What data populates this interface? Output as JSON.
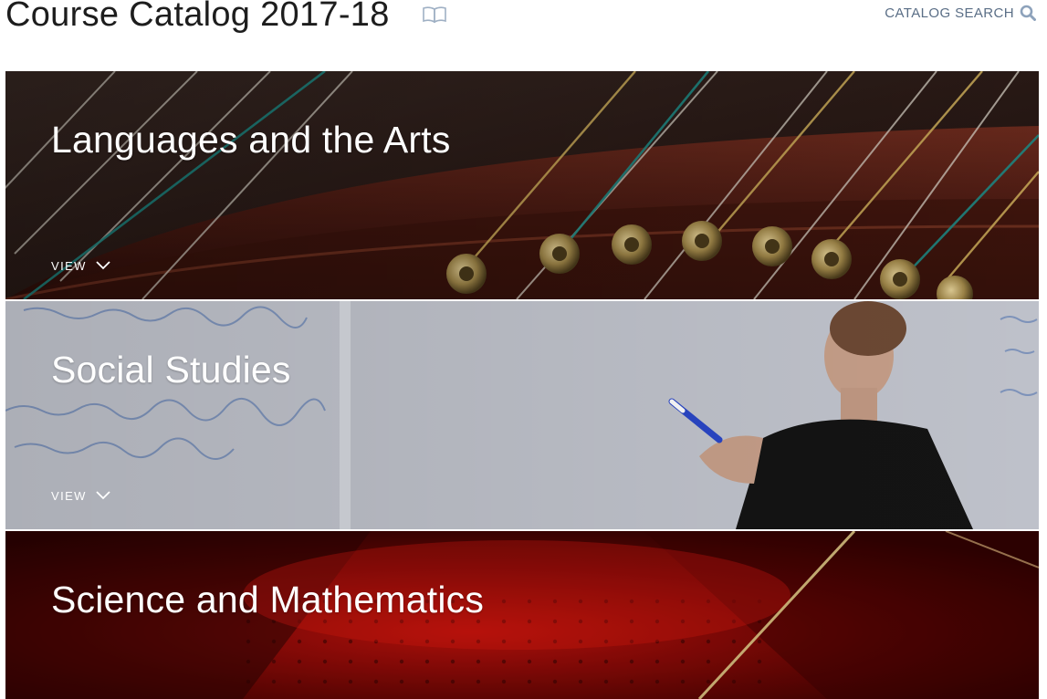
{
  "header": {
    "title": "Course Catalog 2017-18",
    "book_icon": "open-book-icon",
    "search_label": "CATALOG SEARCH",
    "search_icon": "search-icon"
  },
  "panels": [
    {
      "title": "Languages and the Arts",
      "view_label": "VIEW",
      "chevron_icon": "chevron-down-icon",
      "image": "harp-strings-photo"
    },
    {
      "title": "Social Studies",
      "view_label": "VIEW",
      "chevron_icon": "chevron-down-icon",
      "image": "whiteboard-teacher-photo"
    },
    {
      "title": "Science and Mathematics",
      "image": "red-laser-photo"
    }
  ],
  "colors": {
    "title": "#1d1d1d",
    "accent": "#5a6e86",
    "panel_text": "#ffffff"
  }
}
